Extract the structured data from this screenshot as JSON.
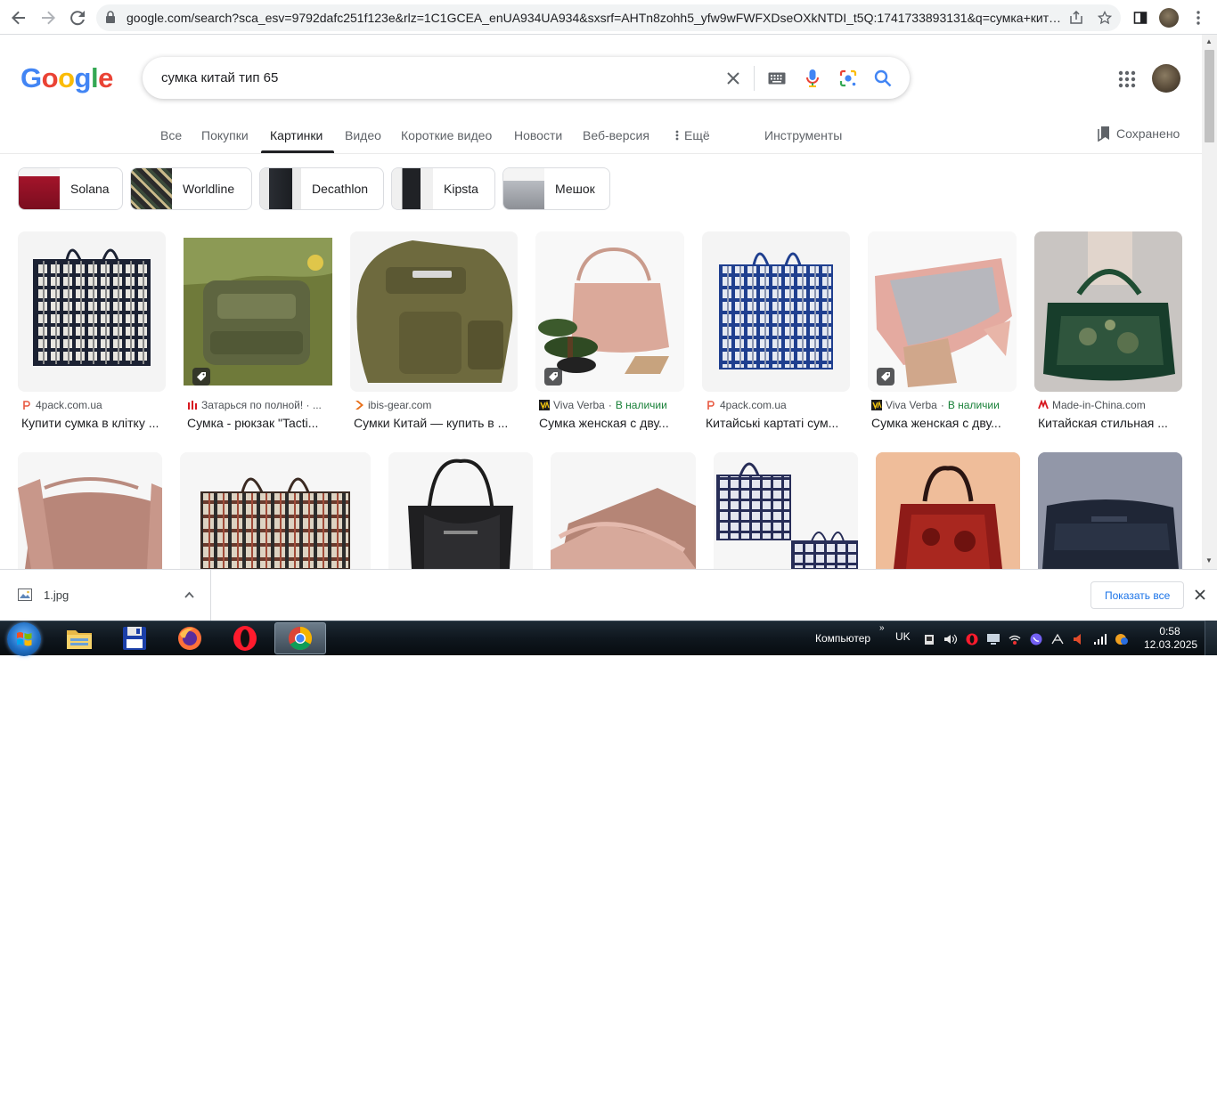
{
  "browser": {
    "url": "google.com/search?sca_esv=9792dafc251f123e&rlz=1C1GCEA_enUA934UA934&sxsrf=AHTn8zohh5_yfw9wFWFXDseOXkNTDI_t5Q:1741733893131&q=сумка+китай+т..."
  },
  "header": {
    "logo": "Google",
    "query": "сумка китай тип 65"
  },
  "tabs": [
    {
      "label": "Все",
      "active": false
    },
    {
      "label": "Покупки",
      "active": false
    },
    {
      "label": "Картинки",
      "active": true
    },
    {
      "label": "Видео",
      "active": false
    },
    {
      "label": "Короткие видео",
      "active": false
    },
    {
      "label": "Новости",
      "active": false
    },
    {
      "label": "Веб-версия",
      "active": false
    },
    {
      "label": "Ещё",
      "active": false
    },
    {
      "label": "Инструменты",
      "active": false
    }
  ],
  "saved_label": "Сохранено",
  "chips": [
    {
      "label": "Solana"
    },
    {
      "label": "Worldline"
    },
    {
      "label": "Decathlon"
    },
    {
      "label": "Kipsta"
    },
    {
      "label": "Мешок"
    }
  ],
  "results_row1": [
    {
      "source": "4pack.com.ua",
      "stock": "",
      "title": "Купити сумка в клітку ..."
    },
    {
      "source": "Затарься по полной! · ...",
      "stock": "",
      "title": "Сумка - рюкзак \"Tacti..."
    },
    {
      "source": "ibis-gear.com",
      "stock": "",
      "title": "Сумки Китай — купить в ..."
    },
    {
      "source": "Viva Verba",
      "stock": "В наличии",
      "title": "Сумка женская с дву..."
    },
    {
      "source": "4pack.com.ua",
      "stock": "",
      "title": "Китайські картаті сум..."
    },
    {
      "source": "Viva Verba",
      "stock": "В наличии",
      "title": "Сумка женская с дву..."
    },
    {
      "source": "Made-in-China.com",
      "stock": "",
      "title": "Китайская стильная ..."
    }
  ],
  "download": {
    "file": "1.jpg",
    "show_all": "Показать все"
  },
  "taskbar": {
    "computer": "Компьютер",
    "lang": "UK",
    "time": "0:58",
    "date": "12.03.2025"
  },
  "colors": {
    "blue": "#4285F4",
    "red": "#EA4335",
    "yellow": "#FBBC05",
    "green": "#34A853",
    "in_stock": "#188038"
  }
}
